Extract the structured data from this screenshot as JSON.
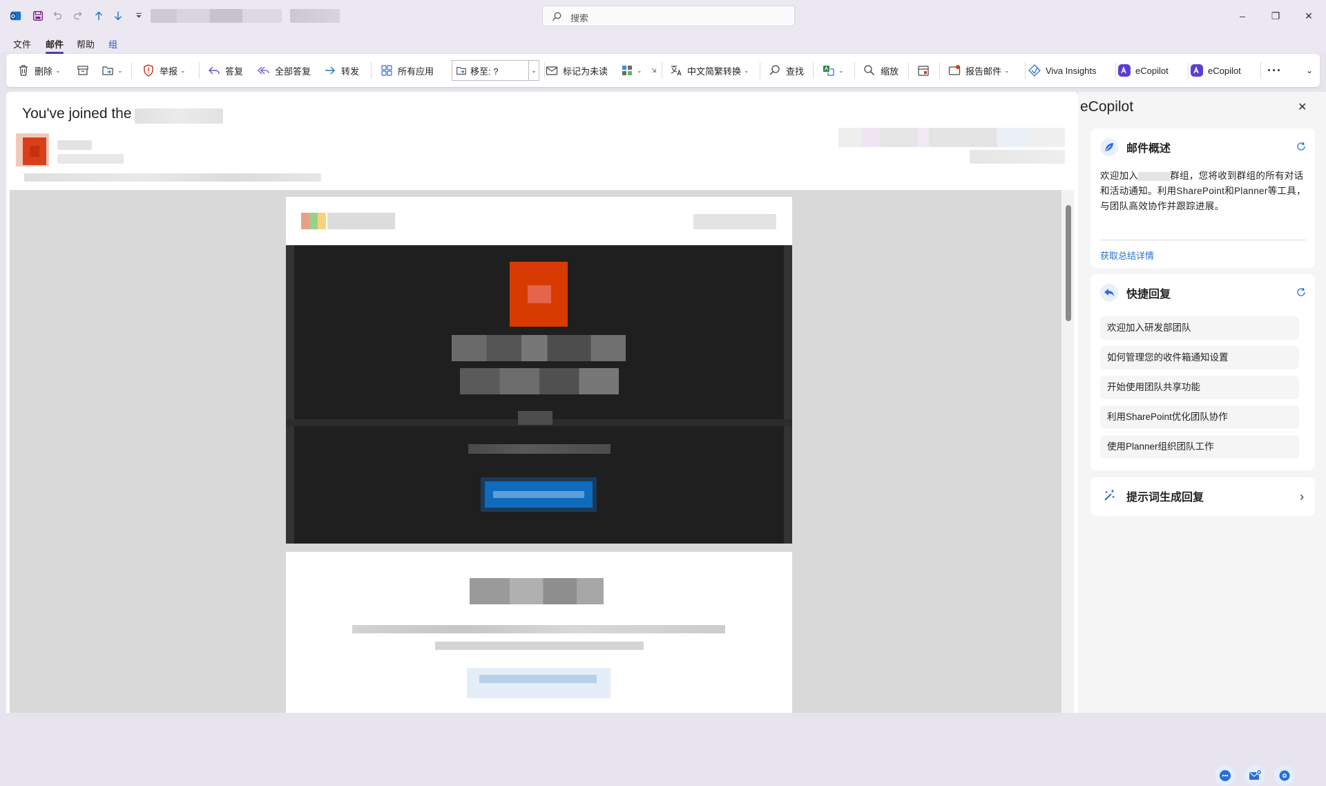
{
  "search": {
    "placeholder": "搜索"
  },
  "window_controls": {
    "minimize": "–",
    "restore": "❐",
    "close": "✕"
  },
  "menu_tabs": [
    {
      "label": "文件",
      "active": false
    },
    {
      "label": "邮件",
      "active": true
    },
    {
      "label": "帮助",
      "active": false
    },
    {
      "label": "组",
      "active": false
    }
  ],
  "ribbon": {
    "delete": "删除",
    "report": "举报",
    "reply": "答复",
    "reply_all": "全部答复",
    "forward": "转发",
    "all_apps": "所有应用",
    "move_to": "移至: ?",
    "mark_unread": "标记为未读",
    "chinese_convert": "中文简繁转换",
    "find": "查找",
    "zoom": "缩放",
    "report_message": "报告邮件",
    "viva": "Viva Insights",
    "ecopilot_1": "eCopilot",
    "ecopilot_2": "eCopilot",
    "more": "···"
  },
  "message": {
    "subject": "You've joined the"
  },
  "side_panel": {
    "title": "eCopilot",
    "close": "✕",
    "summary_card": {
      "title": "邮件概述",
      "text_before": "欢迎加入",
      "text_after": "群组，您将收到群组的所有对话和活动通知。利用SharePoint和Planner等工具，与团队高效协作并跟踪进展。",
      "link": "获取总结详情"
    },
    "quick_reply": {
      "title": "快捷回复",
      "items": [
        "欢迎加入研发部团队",
        "如何管理您的收件箱通知设置",
        "开始使用团队共享功能",
        "利用SharePoint优化团队协作",
        "使用Planner组织团队工作"
      ]
    },
    "prompt_card": {
      "title": "提示词生成回复",
      "chevron": "›"
    }
  },
  "colors": {
    "accent": "#4a3aa8",
    "link": "#2a6fd6",
    "email_banner": "#1f1f1f",
    "group_icon": "#d83b01",
    "cta_button": "#0f6cbd"
  }
}
